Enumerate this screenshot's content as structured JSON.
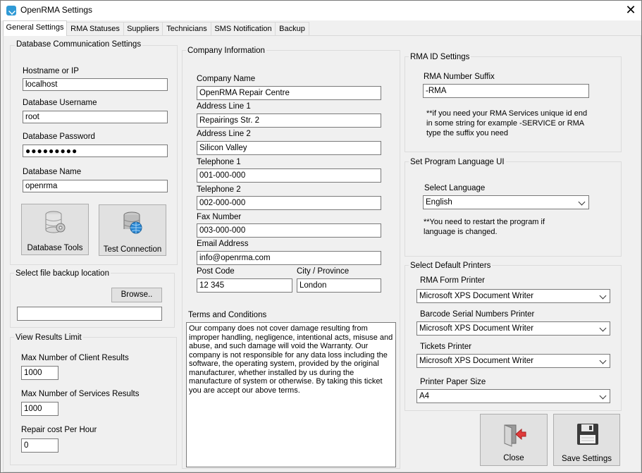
{
  "window": {
    "title": "OpenRMA Settings"
  },
  "tabs": [
    "General Settings",
    "RMA Statuses",
    "Suppliers",
    "Technicians",
    "SMS Notification",
    "Backup"
  ],
  "db": {
    "group_label": "Database Communication Settings",
    "hostname_label": "Hostname or IP",
    "hostname_value": "localhost",
    "username_label": "Database Username",
    "username_value": "root",
    "password_label": "Database Password",
    "password_value": "●●●●●●●●●",
    "dbname_label": "Database Name",
    "dbname_value": "openrma",
    "tools_label": "Database Tools",
    "test_label": "Test Connection"
  },
  "backup": {
    "group_label": "Select file backup location",
    "browse_label": "Browse..",
    "path_value": ""
  },
  "results": {
    "group_label": "View Results Limit",
    "client_label": "Max Number of Client Results",
    "client_value": "1000",
    "services_label": "Max Number of Services Results",
    "services_value": "1000",
    "cost_label": "Repair cost Per Hour",
    "cost_value": "0"
  },
  "company": {
    "group_label": "Company Information",
    "name_label": "Company Name",
    "name_value": "OpenRMA Repair Centre",
    "addr1_label": "Address Line 1",
    "addr1_value": "Repairings Str. 2",
    "addr2_label": "Address Line 2",
    "addr2_value": "Silicon Valley",
    "tel1_label": "Telephone 1",
    "tel1_value": "001-000-000",
    "tel2_label": "Telephone 2",
    "tel2_value": "002-000-000",
    "fax_label": "Fax Number",
    "fax_value": "003-000-000",
    "email_label": "Email Address",
    "email_value": "info@openrma.com",
    "postcode_label": "Post Code",
    "postcode_value": "12 345",
    "city_label": "City / Province",
    "city_value": "London"
  },
  "terms": {
    "label": "Terms and Conditions",
    "text": "Our company does not cover damage resulting from improper handling, negligence, intentional acts, misuse and abuse, and such damage will void the Warranty. Our company is not responsible for any data loss including the software, the operating system, provided by the original manufacturer, whether installed by us during the manufacture of system or otherwise. By taking this ticket you are accept our above terms."
  },
  "rmaid": {
    "group_label": "RMA ID Settings",
    "suffix_label": "RMA Number Suffix",
    "suffix_value": "-RMA",
    "note": "**if you need your RMA Services unique id end in some string for example -SERVICE or RMA type the suffix you need"
  },
  "language": {
    "group_label": "Set Program Language UI",
    "select_label": "Select Language",
    "selected": "English",
    "note": "**You need to restart the program if language is changed."
  },
  "printers": {
    "group_label": "Select Default Printers",
    "rma_label": "RMA Form Printer",
    "rma_value": "Microsoft XPS Document Writer",
    "barcode_label": "Barcode Serial Numbers Printer",
    "barcode_value": "Microsoft XPS Document Writer",
    "tickets_label": "Tickets Printer",
    "tickets_value": "Microsoft XPS Document Writer",
    "paper_label": "Printer Paper Size",
    "paper_value": "A4"
  },
  "actions": {
    "close_label": "Close",
    "save_label": "Save Settings"
  }
}
